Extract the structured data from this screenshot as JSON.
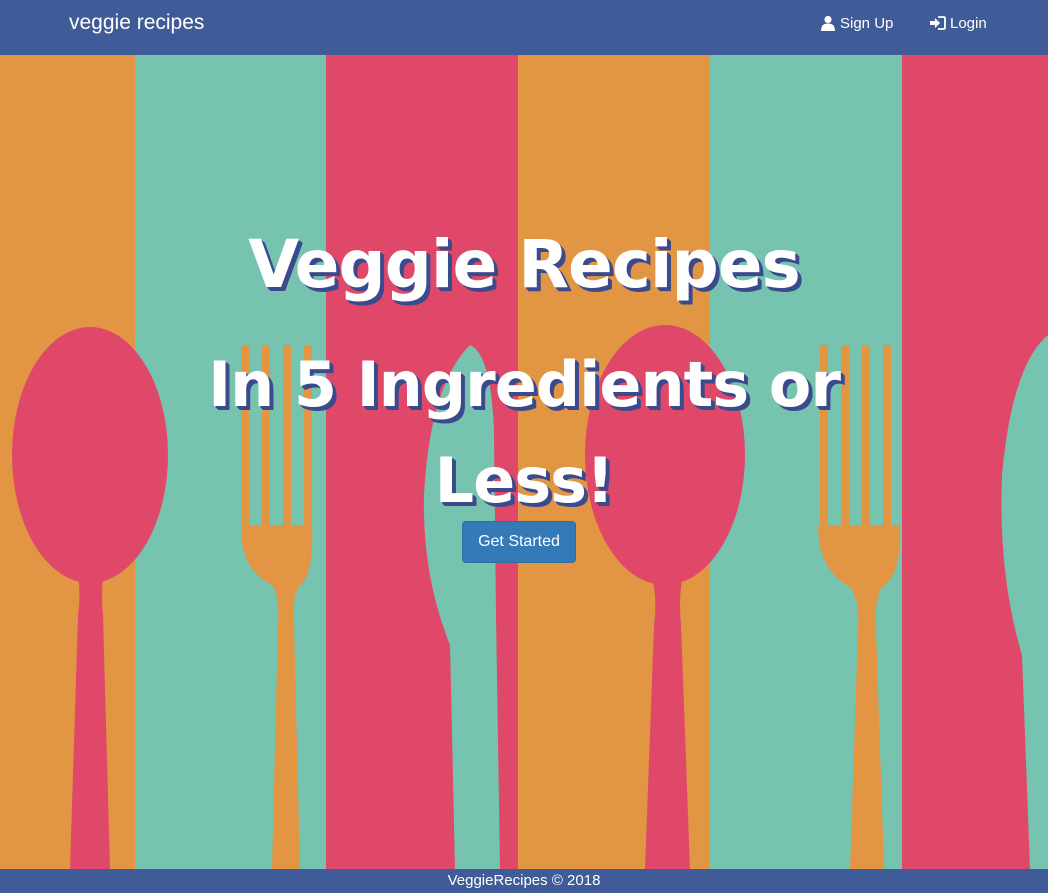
{
  "navbar": {
    "brand": "veggie recipes",
    "links": [
      {
        "label": "Sign Up",
        "icon": "user-icon"
      },
      {
        "label": "Login",
        "icon": "login-icon"
      }
    ]
  },
  "hero": {
    "title_line1": "Veggie Recipes",
    "title_line2": "In 5 Ingredients or Less!",
    "cta_label": "Get Started"
  },
  "footer": {
    "text": "VeggieRecipes © 2018"
  },
  "colors": {
    "navbar": "#3f5c98",
    "orange": "#e29543",
    "teal": "#76c3b0",
    "pink": "#e0486a",
    "button": "#337ab7",
    "title_shadow": "#3b4a8c"
  }
}
